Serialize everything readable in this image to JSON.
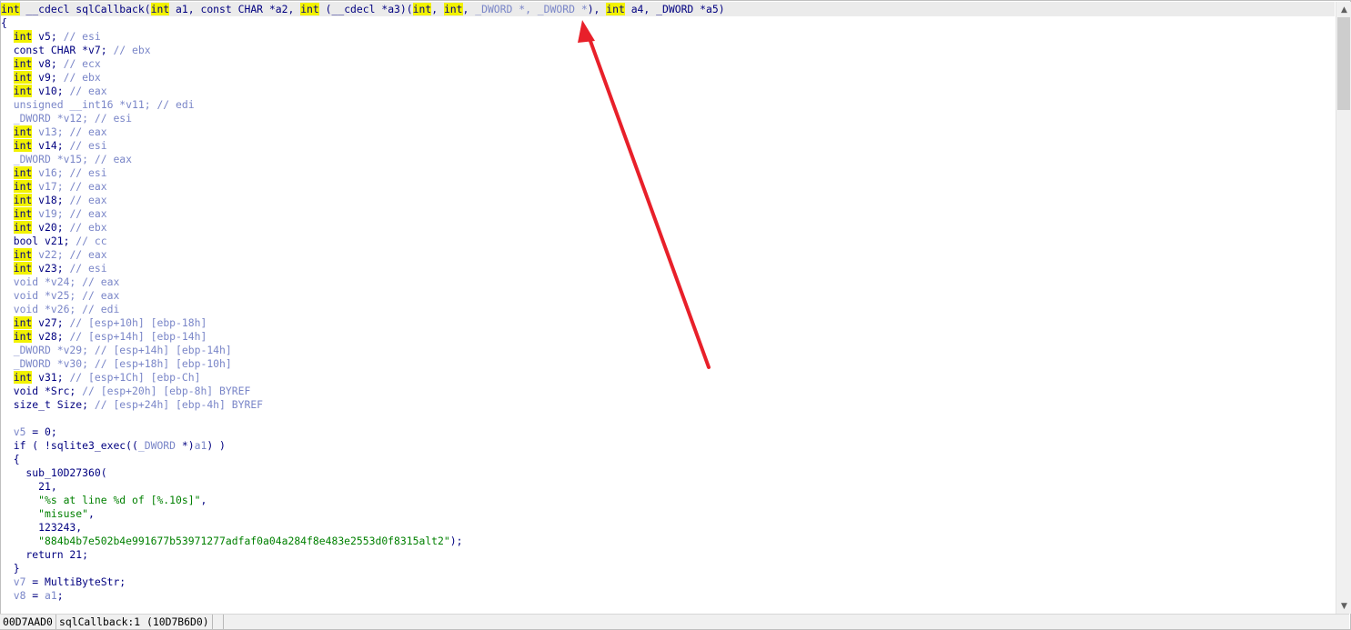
{
  "code_lines": [
    [
      [
        "hl",
        "int"
      ],
      [
        "n",
        " __cdecl sqlCallback("
      ],
      [
        "hl",
        "int"
      ],
      [
        "n",
        " a1, const CHAR *a2, "
      ],
      [
        "hl",
        "int"
      ],
      [
        "n",
        " (__cdecl *a3)("
      ],
      [
        "hl",
        "int"
      ],
      [
        "n",
        ", "
      ],
      [
        "hl",
        "int"
      ],
      [
        "n",
        ", "
      ],
      [
        "g",
        "_DWORD *, _DWORD *"
      ],
      [
        "n",
        "), "
      ],
      [
        "hl",
        "int"
      ],
      [
        "n",
        " a4, _DWORD *a5)"
      ]
    ],
    [
      [
        "n",
        "{"
      ]
    ],
    [
      [
        "n",
        "  "
      ],
      [
        "hl",
        "int"
      ],
      [
        "n",
        " v5; "
      ],
      [
        "c",
        "// esi"
      ]
    ],
    [
      [
        "n",
        "  const CHAR *v7; "
      ],
      [
        "c",
        "// ebx"
      ]
    ],
    [
      [
        "n",
        "  "
      ],
      [
        "hl",
        "int"
      ],
      [
        "n",
        " v8; "
      ],
      [
        "c",
        "// ecx"
      ]
    ],
    [
      [
        "n",
        "  "
      ],
      [
        "hl",
        "int"
      ],
      [
        "n",
        " v9; "
      ],
      [
        "c",
        "// ebx"
      ]
    ],
    [
      [
        "n",
        "  "
      ],
      [
        "hl",
        "int"
      ],
      [
        "n",
        " v10; "
      ],
      [
        "c",
        "// eax"
      ]
    ],
    [
      [
        "g",
        "  unsigned __int16 *v11; "
      ],
      [
        "c",
        "// edi"
      ]
    ],
    [
      [
        "g",
        "  _DWORD *v12; "
      ],
      [
        "c",
        "// esi"
      ]
    ],
    [
      [
        "n",
        "  "
      ],
      [
        "hl",
        "int"
      ],
      [
        "g",
        " v13; "
      ],
      [
        "c",
        "// eax"
      ]
    ],
    [
      [
        "n",
        "  "
      ],
      [
        "hl",
        "int"
      ],
      [
        "n",
        " v14; "
      ],
      [
        "c",
        "// esi"
      ]
    ],
    [
      [
        "g",
        "  _DWORD *v15; "
      ],
      [
        "c",
        "// eax"
      ]
    ],
    [
      [
        "n",
        "  "
      ],
      [
        "hl",
        "int"
      ],
      [
        "g",
        " v16; "
      ],
      [
        "c",
        "// esi"
      ]
    ],
    [
      [
        "n",
        "  "
      ],
      [
        "hl",
        "int"
      ],
      [
        "g",
        " v17; "
      ],
      [
        "c",
        "// eax"
      ]
    ],
    [
      [
        "n",
        "  "
      ],
      [
        "hl",
        "int"
      ],
      [
        "n",
        " v18; "
      ],
      [
        "c",
        "// eax"
      ]
    ],
    [
      [
        "n",
        "  "
      ],
      [
        "hl",
        "int"
      ],
      [
        "g",
        " v19; "
      ],
      [
        "c",
        "// eax"
      ]
    ],
    [
      [
        "n",
        "  "
      ],
      [
        "hl",
        "int"
      ],
      [
        "n",
        " v20; "
      ],
      [
        "c",
        "// ebx"
      ]
    ],
    [
      [
        "n",
        "  bool v21; "
      ],
      [
        "c",
        "// cc"
      ]
    ],
    [
      [
        "n",
        "  "
      ],
      [
        "hl",
        "int"
      ],
      [
        "g",
        " v22; "
      ],
      [
        "c",
        "// eax"
      ]
    ],
    [
      [
        "n",
        "  "
      ],
      [
        "hl",
        "int"
      ],
      [
        "n",
        " v23; "
      ],
      [
        "c",
        "// esi"
      ]
    ],
    [
      [
        "g",
        "  void *v24; "
      ],
      [
        "c",
        "// eax"
      ]
    ],
    [
      [
        "g",
        "  void *v25; "
      ],
      [
        "c",
        "// eax"
      ]
    ],
    [
      [
        "g",
        "  void *v26; "
      ],
      [
        "c",
        "// edi"
      ]
    ],
    [
      [
        "n",
        "  "
      ],
      [
        "hl",
        "int"
      ],
      [
        "n",
        " v27; "
      ],
      [
        "c",
        "// [esp+10h] [ebp-18h]"
      ]
    ],
    [
      [
        "n",
        "  "
      ],
      [
        "hl",
        "int"
      ],
      [
        "n",
        " v28; "
      ],
      [
        "c",
        "// [esp+14h] [ebp-14h]"
      ]
    ],
    [
      [
        "g",
        "  _DWORD *v29; "
      ],
      [
        "c",
        "// [esp+14h] [ebp-14h]"
      ]
    ],
    [
      [
        "g",
        "  _DWORD *v30; "
      ],
      [
        "c",
        "// [esp+18h] [ebp-10h]"
      ]
    ],
    [
      [
        "n",
        "  "
      ],
      [
        "hl",
        "int"
      ],
      [
        "n",
        " v31; "
      ],
      [
        "c",
        "// [esp+1Ch] [ebp-Ch]"
      ]
    ],
    [
      [
        "n",
        "  void *Src; "
      ],
      [
        "c",
        "// [esp+20h] [ebp-8h] BYREF"
      ]
    ],
    [
      [
        "n",
        "  size_t Size; "
      ],
      [
        "c",
        "// [esp+24h] [ebp-4h] BYREF"
      ]
    ],
    [
      [
        "n",
        ""
      ]
    ],
    [
      [
        "g",
        "  v5"
      ],
      [
        "n",
        " = 0;"
      ]
    ],
    [
      [
        "n",
        "  if ( !sqlite3_exec(("
      ],
      [
        "g",
        "_DWORD"
      ],
      [
        "n",
        " *)"
      ],
      [
        "g",
        "a1"
      ],
      [
        "n",
        ") )"
      ]
    ],
    [
      [
        "n",
        "  {"
      ]
    ],
    [
      [
        "n",
        "    sub_10D27360("
      ]
    ],
    [
      [
        "n",
        "      21,"
      ]
    ],
    [
      [
        "s",
        "      \"%s at line %d of [%.10s]\""
      ],
      [
        "n",
        ","
      ]
    ],
    [
      [
        "s",
        "      \"misuse\""
      ],
      [
        "n",
        ","
      ]
    ],
    [
      [
        "n",
        "      123243,"
      ]
    ],
    [
      [
        "s",
        "      \"884b4b7e502b4e991677b53971277adfaf0a04a284f8e483e2553d0f8315alt2\""
      ],
      [
        "n",
        ");"
      ]
    ],
    [
      [
        "n",
        "    return 21;"
      ]
    ],
    [
      [
        "n",
        "  }"
      ]
    ],
    [
      [
        "g",
        "  v7"
      ],
      [
        "n",
        " = MultiByteStr;"
      ]
    ],
    [
      [
        "g",
        "  v8"
      ],
      [
        "n",
        " = "
      ],
      [
        "g",
        "a1"
      ],
      [
        "n",
        ";"
      ]
    ]
  ],
  "status_bar": {
    "address": "00D7AAD0",
    "location": "sqlCallback:1 (10D7B6D0)"
  },
  "scrollbar": {
    "up_icon": "▲",
    "down_icon": "▼",
    "position_fraction": 0.0
  },
  "colors": {
    "keyword_highlight": "#f2f200",
    "code_text": "#000080",
    "comment": "#7a86c8",
    "string": "#008000",
    "annotation_arrow": "#e8202a"
  }
}
